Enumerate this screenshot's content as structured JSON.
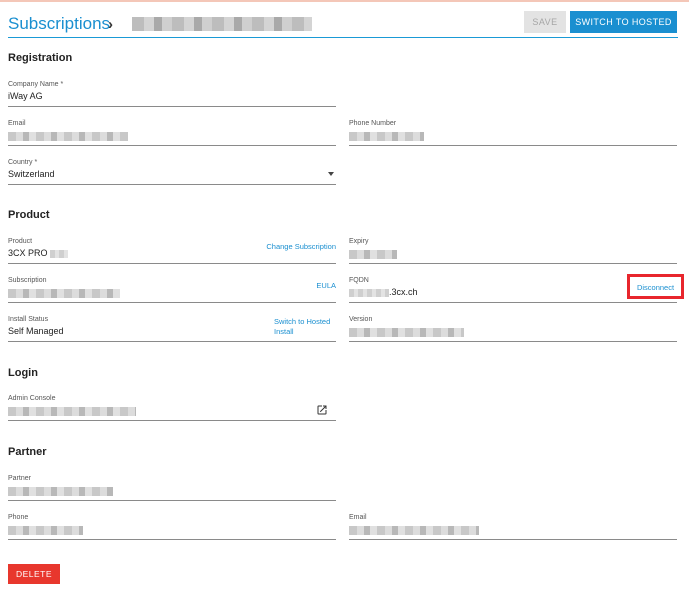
{
  "header": {
    "title": "Subscriptions",
    "save_label": "SAVE",
    "switch_hosted_label": "SWITCH TO HOSTED"
  },
  "registration": {
    "heading": "Registration",
    "company_label": "Company Name *",
    "company_value": "iWay AG",
    "email_label": "Email",
    "phone_label": "Phone Number",
    "country_label": "Country *",
    "country_value": "Switzerland"
  },
  "product": {
    "heading": "Product",
    "product_label": "Product",
    "product_value": "3CX PRO",
    "change_subscription": "Change Subscription",
    "expiry_label": "Expiry",
    "subscription_label": "Subscription",
    "eula": "EULA",
    "fqdn_label": "FQDN",
    "fqdn_suffix": ".3cx.ch",
    "disconnect": "Disconnect",
    "install_status_label": "Install Status",
    "install_status_value": "Self Managed",
    "switch_hosted_link": "Switch to Hosted Install",
    "version_label": "Version"
  },
  "login": {
    "heading": "Login",
    "admin_console_label": "Admin Console"
  },
  "partner": {
    "heading": "Partner",
    "partner_label": "Partner",
    "phone_label": "Phone",
    "email_label": "Email"
  },
  "footer": {
    "delete_label": "DELETE"
  },
  "icons": {
    "breadcrumb_separator": "chevron-right-icon",
    "country_dropdown": "caret-down-icon",
    "admin_console_open": "open-in-new-icon"
  },
  "colors": {
    "accent": "#1a8fd0",
    "danger": "#e8372d",
    "highlight_box": "#e8262d"
  }
}
